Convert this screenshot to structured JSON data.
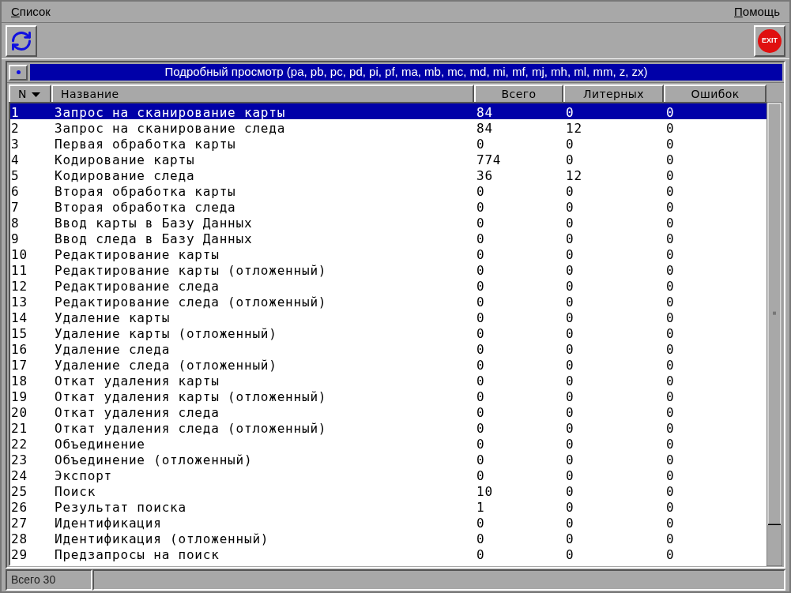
{
  "menu": [
    {
      "label": "Список"
    },
    {
      "label": "Помощь"
    }
  ],
  "toolbar": {
    "exit_label": "EXIT"
  },
  "panel_title": "Подробный просмотр (pa, pb, pc, pd, pi, pf, ma, mb, mc, md, mi, mf, mj, mh, ml, mm, z, zx)",
  "table": {
    "columns": [
      "N",
      "Название",
      "Всего",
      "Литерных",
      "Ошибок"
    ],
    "rows": [
      {
        "cells": [
          "1",
          "Запрос на сканирование карты",
          "84",
          "0",
          "0"
        ],
        "selected": true
      },
      {
        "cells": [
          "2",
          "Запрос на сканирование следа",
          "84",
          "12",
          "0"
        ],
        "selected": false
      },
      {
        "cells": [
          "3",
          "Первая обработка карты",
          "0",
          "0",
          "0"
        ],
        "selected": false
      },
      {
        "cells": [
          "4",
          "Кодирование карты",
          "774",
          "0",
          "0"
        ],
        "selected": false
      },
      {
        "cells": [
          "5",
          "Кодирование следа",
          "36",
          "12",
          "0"
        ],
        "selected": false
      },
      {
        "cells": [
          "6",
          "Вторая обработка карты",
          "0",
          "0",
          "0"
        ],
        "selected": false
      },
      {
        "cells": [
          "7",
          "Вторая обработка следа",
          "0",
          "0",
          "0"
        ],
        "selected": false
      },
      {
        "cells": [
          "8",
          "Ввод карты в Базу Данных",
          "0",
          "0",
          "0"
        ],
        "selected": false
      },
      {
        "cells": [
          "9",
          "Ввод следа в Базу Данных",
          "0",
          "0",
          "0"
        ],
        "selected": false
      },
      {
        "cells": [
          "10",
          "Редактирование карты",
          "0",
          "0",
          "0"
        ],
        "selected": false
      },
      {
        "cells": [
          "11",
          "Редактирование карты (отложенный)",
          "0",
          "0",
          "0"
        ],
        "selected": false
      },
      {
        "cells": [
          "12",
          "Редактирование следа",
          "0",
          "0",
          "0"
        ],
        "selected": false
      },
      {
        "cells": [
          "13",
          "Редактирование следа (отложенный)",
          "0",
          "0",
          "0"
        ],
        "selected": false
      },
      {
        "cells": [
          "14",
          "Удаление карты",
          "0",
          "0",
          "0"
        ],
        "selected": false
      },
      {
        "cells": [
          "15",
          "Удаление карты (отложенный)",
          "0",
          "0",
          "0"
        ],
        "selected": false
      },
      {
        "cells": [
          "16",
          "Удаление следа",
          "0",
          "0",
          "0"
        ],
        "selected": false
      },
      {
        "cells": [
          "17",
          "Удаление следа (отложенный)",
          "0",
          "0",
          "0"
        ],
        "selected": false
      },
      {
        "cells": [
          "18",
          "Откат удаления карты",
          "0",
          "0",
          "0"
        ],
        "selected": false
      },
      {
        "cells": [
          "19",
          "Откат удаления карты (отложенный)",
          "0",
          "0",
          "0"
        ],
        "selected": false
      },
      {
        "cells": [
          "20",
          "Откат удаления следа",
          "0",
          "0",
          "0"
        ],
        "selected": false
      },
      {
        "cells": [
          "21",
          "Откат удаления следа (отложенный)",
          "0",
          "0",
          "0"
        ],
        "selected": false
      },
      {
        "cells": [
          "22",
          "Объединение",
          "0",
          "0",
          "0"
        ],
        "selected": false
      },
      {
        "cells": [
          "23",
          "Объединение (отложенный)",
          "0",
          "0",
          "0"
        ],
        "selected": false
      },
      {
        "cells": [
          "24",
          "Экспорт",
          "0",
          "0",
          "0"
        ],
        "selected": false
      },
      {
        "cells": [
          "25",
          "Поиск",
          "10",
          "0",
          "0"
        ],
        "selected": false
      },
      {
        "cells": [
          "26",
          "Результат поиска",
          "1",
          "0",
          "0"
        ],
        "selected": false
      },
      {
        "cells": [
          "27",
          "Идентификация",
          "0",
          "0",
          "0"
        ],
        "selected": false
      },
      {
        "cells": [
          "28",
          "Идентификация (отложенный)",
          "0",
          "0",
          "0"
        ],
        "selected": false
      },
      {
        "cells": [
          "29",
          "Предзапросы на поиск",
          "0",
          "0",
          "0"
        ],
        "selected": false
      }
    ]
  },
  "status_bar": {
    "text": "Всего 30"
  }
}
